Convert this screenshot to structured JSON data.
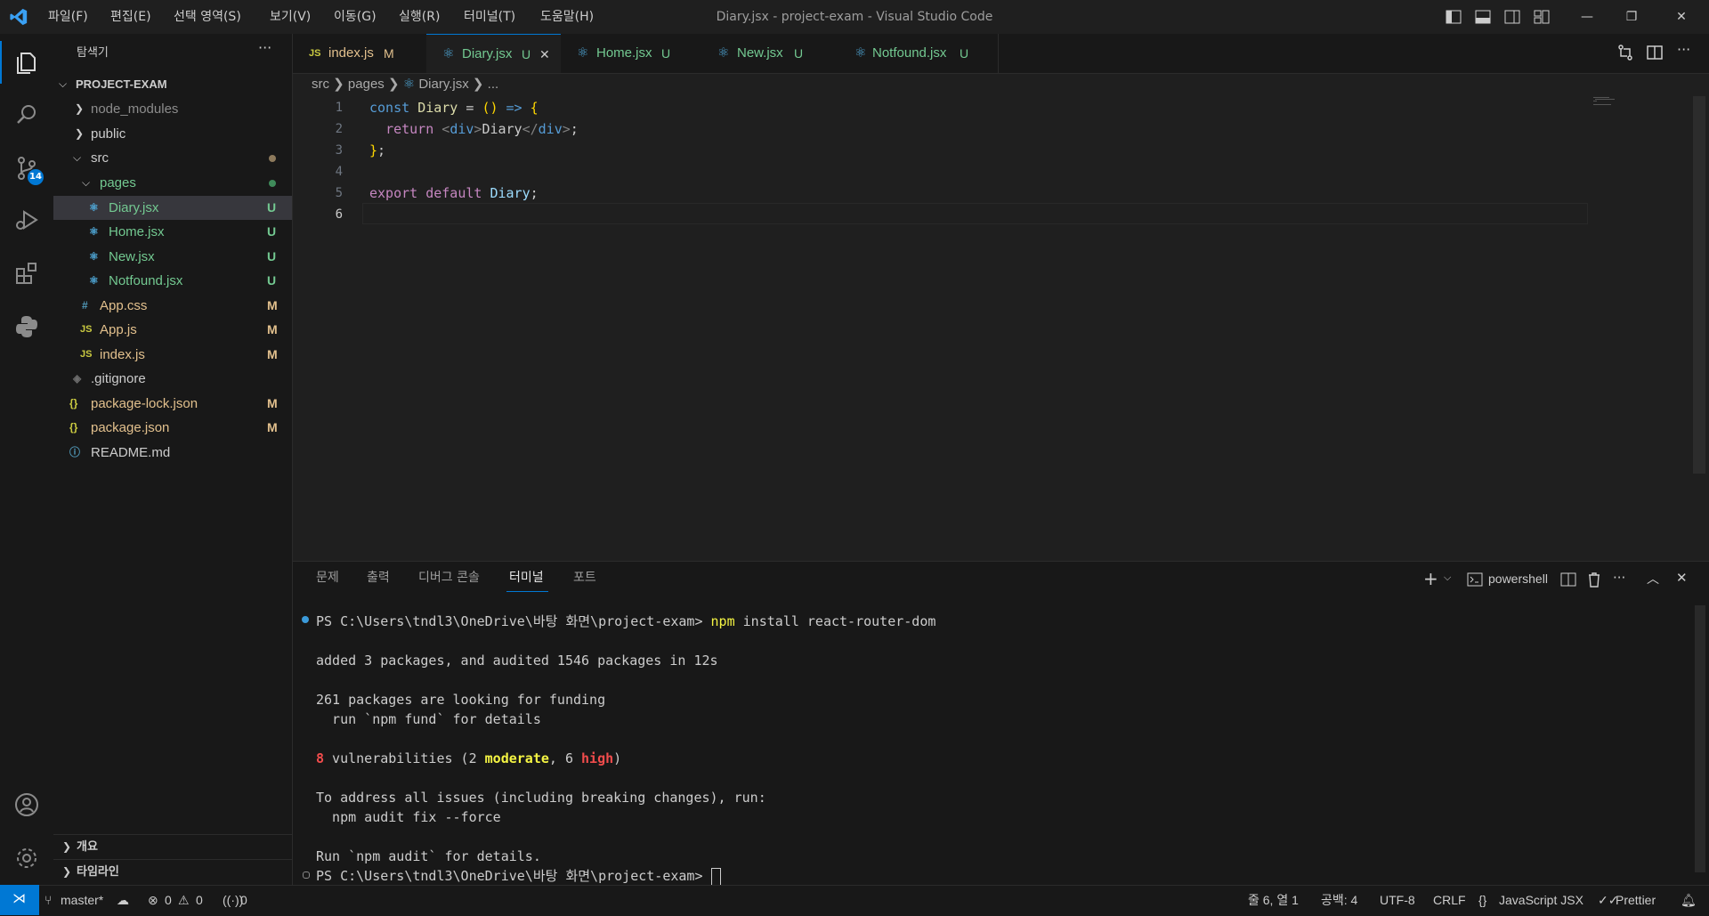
{
  "window": {
    "title": "Diary.jsx - project-exam - Visual Studio Code",
    "menu": [
      "파일(F)",
      "편집(E)",
      "선택 영역(S)",
      "보기(V)",
      "이동(G)",
      "실행(R)",
      "터미널(T)",
      "도움말(H)"
    ]
  },
  "activity": {
    "scm_badge": "14"
  },
  "sidebar": {
    "title": "탐색기",
    "more": "···",
    "project": "PROJECT-EXAM",
    "items": [
      {
        "label": "node_modules",
        "status": ""
      },
      {
        "label": "public",
        "status": ""
      },
      {
        "label": "src",
        "status": ""
      },
      {
        "label": "pages",
        "status": ""
      },
      {
        "label": "Diary.jsx",
        "status": "U"
      },
      {
        "label": "Home.jsx",
        "status": "U"
      },
      {
        "label": "New.jsx",
        "status": "U"
      },
      {
        "label": "Notfound.jsx",
        "status": "U"
      },
      {
        "label": "App.css",
        "status": "M"
      },
      {
        "label": "App.js",
        "status": "M"
      },
      {
        "label": "index.js",
        "status": "M"
      },
      {
        "label": ".gitignore",
        "status": ""
      },
      {
        "label": "package-lock.json",
        "status": "M"
      },
      {
        "label": "package.json",
        "status": "M"
      },
      {
        "label": "README.md",
        "status": ""
      }
    ],
    "outline": "개요",
    "timeline": "타임라인"
  },
  "tabs": [
    {
      "label": "index.js",
      "status": "M"
    },
    {
      "label": "Diary.jsx",
      "status": "U"
    },
    {
      "label": "Home.jsx",
      "status": "U"
    },
    {
      "label": "New.jsx",
      "status": "U"
    },
    {
      "label": "Notfound.jsx",
      "status": "U"
    }
  ],
  "breadcrumb": [
    "src",
    "pages",
    "Diary.jsx",
    "..."
  ],
  "editor": {
    "line_numbers": [
      "1",
      "2",
      "3",
      "4",
      "5",
      "6"
    ]
  },
  "panel": {
    "tabs": [
      "문제",
      "출력",
      "디버그 콘솔",
      "터미널",
      "포트"
    ],
    "shell": "powershell",
    "prompt": "PS C:\\Users\\tndl3\\OneDrive\\바탕 화면\\project-exam>",
    "command_npm": "npm",
    "command_rest": " install react-router-dom",
    "out_added": "added 3 packages, and audited 1546 packages in 12s",
    "out_funding": "261 packages are looking for funding",
    "out_fund": "  run `npm fund` for details",
    "vuln_count": "8",
    "vuln_text": " vulnerabilities (2 ",
    "vuln_moderate": "moderate",
    "vuln_mid": ", 6 ",
    "vuln_high": "high",
    "vuln_end": ")",
    "out_address": "To address all issues (including breaking changes), run:",
    "out_fix": "  npm audit fix --force",
    "out_run_audit": "Run `npm audit` for details."
  },
  "status": {
    "branch": "master*",
    "errors": "0",
    "warnings": "0",
    "ports": "0",
    "position": "줄 6, 열 1",
    "spaces": "공백: 4",
    "encoding": "UTF-8",
    "eol": "CRLF",
    "language": "JavaScript JSX",
    "formatter": "Prettier"
  },
  "colors": {
    "accent": "#0078d4",
    "untracked": "#73c991",
    "modified": "#e2c08d"
  }
}
